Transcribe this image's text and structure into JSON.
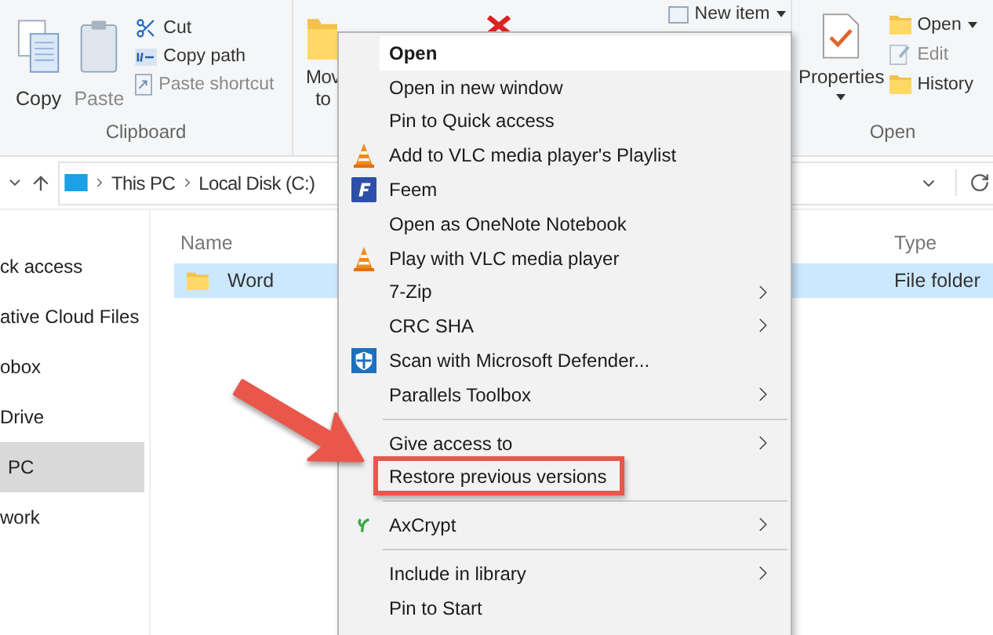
{
  "ribbon": {
    "clipboard": {
      "large": [
        {
          "label": "Copy",
          "disabled": false
        },
        {
          "label": "Paste",
          "disabled": true
        }
      ],
      "small": [
        {
          "label": "Cut",
          "disabled": false
        },
        {
          "label": "Copy path",
          "disabled": false
        },
        {
          "label": "Paste shortcut",
          "disabled": true
        }
      ],
      "label": "Clipboard"
    },
    "organize": {
      "move_lines": [
        "Mov",
        "to"
      ]
    },
    "new": {
      "new_item": "New item"
    },
    "open": {
      "properties": "Properties",
      "small": [
        {
          "label": "Open",
          "disabled": false,
          "dropdown": true
        },
        {
          "label": "Edit",
          "disabled": true,
          "dropdown": false
        },
        {
          "label": "History",
          "disabled": false,
          "dropdown": false
        }
      ],
      "label": "Open"
    }
  },
  "address": {
    "crumbs": [
      "This PC",
      "Local Disk (C:)"
    ]
  },
  "nav": [
    {
      "label": "ck access",
      "selected": false
    },
    {
      "label": "ative Cloud Files",
      "selected": false
    },
    {
      "label": "obox",
      "selected": false
    },
    {
      "label": "Drive",
      "selected": false
    },
    {
      "label": "PC",
      "selected": true
    },
    {
      "label": "work",
      "selected": false
    }
  ],
  "files": {
    "columns": [
      "Name",
      "Type"
    ],
    "rows": [
      {
        "name": "Word",
        "type": "File folder",
        "selected": true
      }
    ]
  },
  "context_menu": [
    {
      "kind": "item",
      "label": "Open",
      "bold": true,
      "hovered": true,
      "submenu": false,
      "callout": false
    },
    {
      "kind": "item",
      "label": "Open in new window",
      "bold": false,
      "hovered": false,
      "submenu": false,
      "callout": false
    },
    {
      "kind": "item",
      "label": "Pin to Quick access",
      "bold": false,
      "hovered": false,
      "submenu": false,
      "callout": false
    },
    {
      "kind": "item",
      "label": "Add to VLC media player's Playlist",
      "bold": false,
      "hovered": false,
      "submenu": false,
      "callout": false
    },
    {
      "kind": "item",
      "label": "Feem",
      "bold": false,
      "hovered": false,
      "submenu": false,
      "callout": false
    },
    {
      "kind": "item",
      "label": "Open as OneNote Notebook",
      "bold": false,
      "hovered": false,
      "submenu": false,
      "callout": false
    },
    {
      "kind": "item",
      "label": "Play with VLC media player",
      "bold": false,
      "hovered": false,
      "submenu": false,
      "callout": false
    },
    {
      "kind": "item",
      "label": "7-Zip",
      "bold": false,
      "hovered": false,
      "submenu": true,
      "callout": false
    },
    {
      "kind": "item",
      "label": "CRC SHA",
      "bold": false,
      "hovered": false,
      "submenu": true,
      "callout": false
    },
    {
      "kind": "item",
      "label": "Scan with Microsoft Defender...",
      "bold": false,
      "hovered": false,
      "submenu": false,
      "callout": false
    },
    {
      "kind": "item",
      "label": "Parallels Toolbox",
      "bold": false,
      "hovered": false,
      "submenu": true,
      "callout": false
    },
    {
      "kind": "separator"
    },
    {
      "kind": "item",
      "label": "Give access to",
      "bold": false,
      "hovered": false,
      "submenu": true,
      "callout": false
    },
    {
      "kind": "item",
      "label": "Restore previous versions",
      "bold": false,
      "hovered": false,
      "submenu": false,
      "callout": true
    },
    {
      "kind": "separator"
    },
    {
      "kind": "item",
      "label": "AxCrypt",
      "bold": false,
      "hovered": false,
      "submenu": true,
      "callout": false
    },
    {
      "kind": "separator"
    },
    {
      "kind": "item",
      "label": "Include in library",
      "bold": false,
      "hovered": false,
      "submenu": true,
      "callout": false
    },
    {
      "kind": "item",
      "label": "Pin to Start",
      "bold": false,
      "hovered": false,
      "submenu": false,
      "callout": false
    }
  ]
}
